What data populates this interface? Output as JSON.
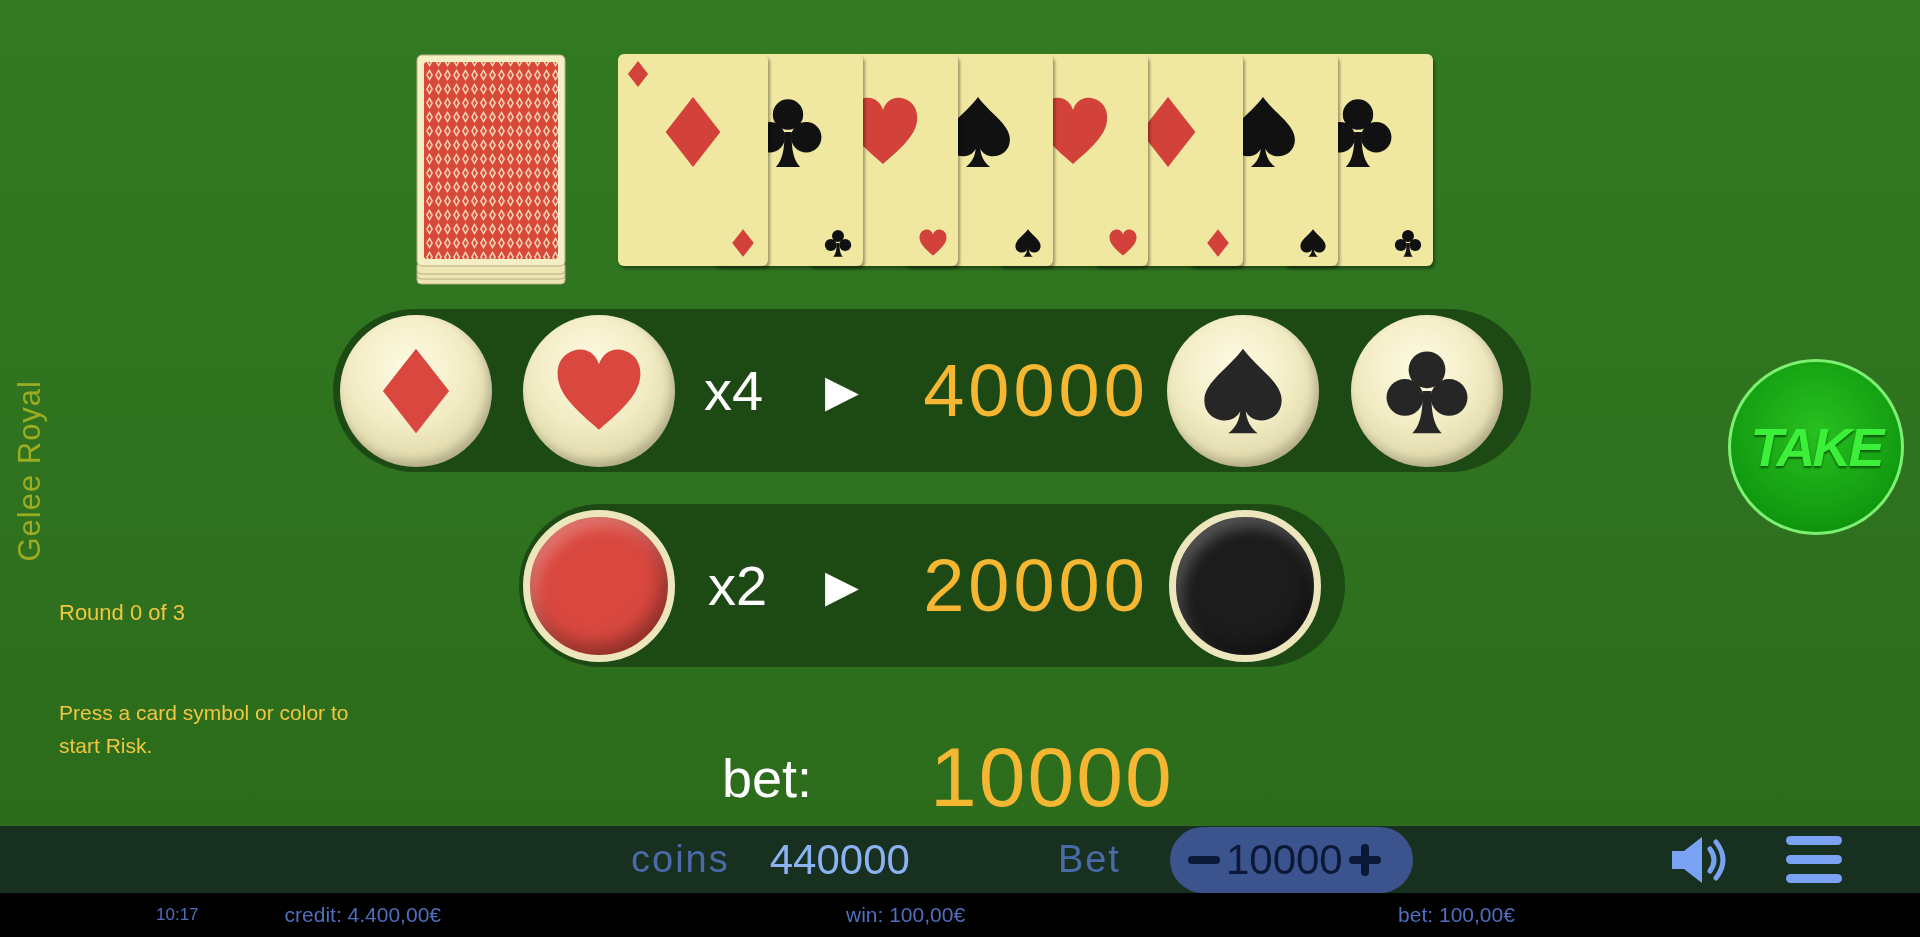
{
  "game_title": "Gelee Royal",
  "round_text": "Round 0 of 3",
  "instruction": "Press a card symbol or color to start Risk.",
  "history_cards": [
    {
      "kind": "diamonds"
    },
    {
      "kind": "clubs"
    },
    {
      "kind": "hearts"
    },
    {
      "kind": "spades"
    },
    {
      "kind": "hearts"
    },
    {
      "kind": "diamonds"
    },
    {
      "kind": "spades"
    },
    {
      "kind": "clubs"
    }
  ],
  "suit_bet": {
    "buttons": [
      {
        "kind": "diamonds"
      },
      {
        "kind": "hearts"
      },
      {
        "kind": "spades"
      },
      {
        "kind": "clubs"
      }
    ],
    "multiplier": "x4",
    "arrow": "▶",
    "win": "40000"
  },
  "color_bet": {
    "buttons": [
      {
        "color": "#d9483f"
      },
      {
        "color": "#1c1c1c"
      }
    ],
    "multiplier": "x2",
    "arrow": "▶",
    "win": "20000"
  },
  "bet": {
    "label": "bet:",
    "value": "10000"
  },
  "take_button": "TAKE",
  "bottom_bar": {
    "coins_label": "coins",
    "coins": "440000",
    "bet_label": "Bet",
    "bet_value": "10000"
  },
  "status_bar": {
    "time": "10:17",
    "credit": "credit: 4.400,00€",
    "win": "win: 100,00€",
    "bet": "bet: 100,00€"
  }
}
